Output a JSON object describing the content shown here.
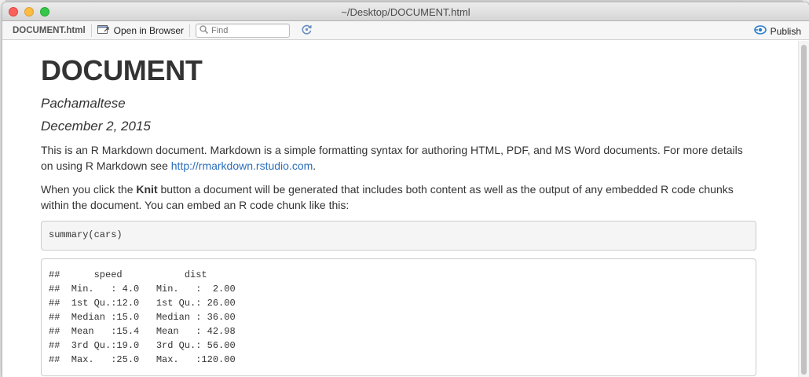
{
  "window": {
    "title": "~/Desktop/DOCUMENT.html"
  },
  "toolbar": {
    "file_label": "DOCUMENT.html",
    "open_in_browser": "Open in Browser",
    "find_placeholder": "Find",
    "publish": "Publish"
  },
  "document": {
    "title": "DOCUMENT",
    "author": "Pachamaltese",
    "date": "December 2, 2015",
    "para1_text": "This is an R Markdown document. Markdown is a simple formatting syntax for authoring HTML, PDF, and MS Word documents. For more details on using R Markdown see ",
    "para1_link": "http://rmarkdown.rstudio.com",
    "para1_end": ".",
    "para2_before": "When you click the ",
    "para2_bold": "Knit",
    "para2_after": " button a document will be generated that includes both content as well as the output of any embedded R code chunks within the document. You can embed an R code chunk like this:",
    "code": "summary(cars)",
    "output_lines": [
      "##      speed           dist       ",
      "##  Min.   : 4.0   Min.   :  2.00  ",
      "##  1st Qu.:12.0   1st Qu.: 26.00  ",
      "##  Median :15.0   Median : 36.00  ",
      "##  Mean   :15.4   Mean   : 42.98  ",
      "##  3rd Qu.:19.0   3rd Qu.: 56.00  ",
      "##  Max.   :25.0   Max.   :120.00  "
    ]
  },
  "colors": {
    "link": "#2a6ebb",
    "close": "#fc605c",
    "minimize": "#fdbc40",
    "maximize": "#34c84a",
    "publish_icon": "#2a7fcf"
  },
  "icons": {
    "open_in_browser": "browser-window-icon",
    "find": "search-icon",
    "refresh": "refresh-icon",
    "publish": "publish-icon"
  }
}
